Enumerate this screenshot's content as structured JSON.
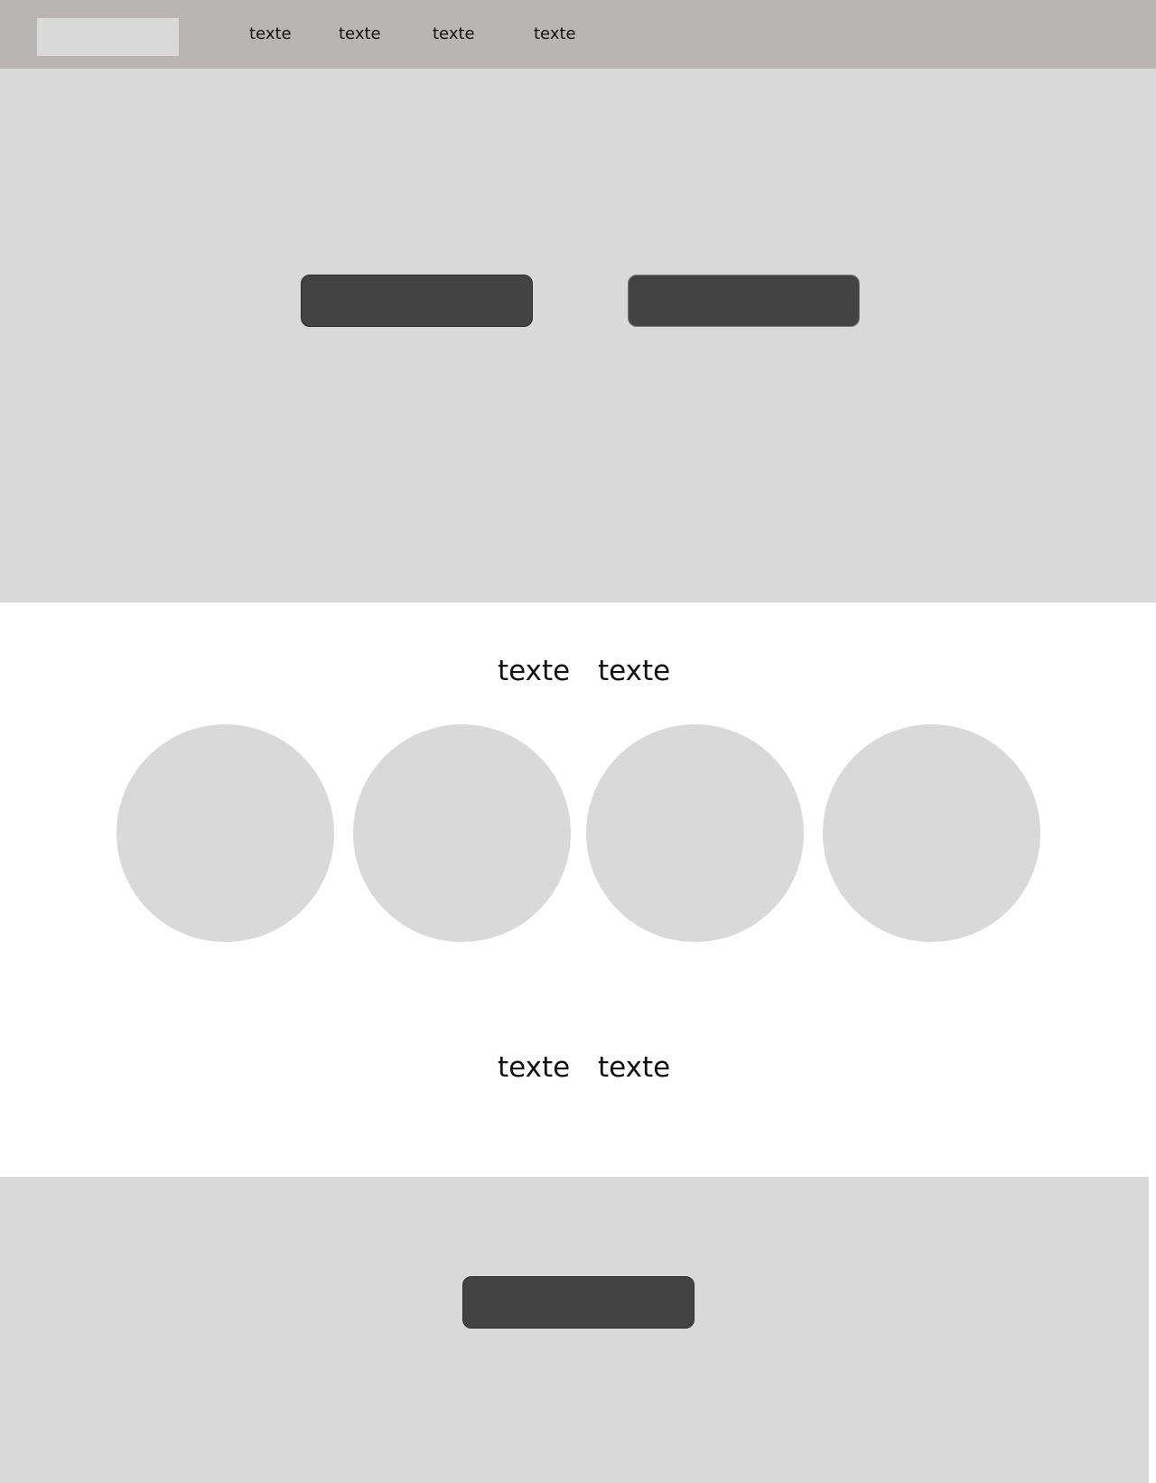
{
  "header": {
    "nav": [
      "texte",
      "texte",
      "texte",
      "texte"
    ]
  },
  "hero": {
    "buttons": [
      "",
      ""
    ]
  },
  "section1": {
    "heading_words": [
      "texte",
      "texte"
    ]
  },
  "section2": {
    "heading_words": [
      "texte",
      "texte"
    ]
  },
  "footer": {
    "button_label": ""
  },
  "colors": {
    "header_bg": "#b9b5b4",
    "placeholder_gray": "#d9d9d9",
    "button_dark": "#434343",
    "page_bg": "#ffffff"
  }
}
